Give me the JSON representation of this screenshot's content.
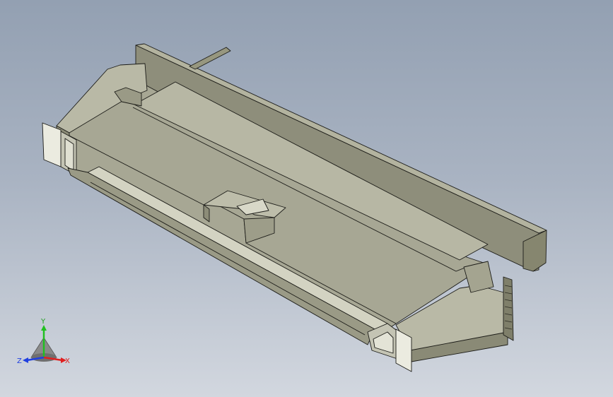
{
  "viewport": {
    "background_top": "#93a0b2",
    "background_bottom": "#d2d7df",
    "part_color": "#a3a38f",
    "edge_color": "#1c1c18"
  },
  "triad": {
    "x_label": "X",
    "y_label": "Y",
    "z_label": "Z",
    "x_color": "#e02020",
    "y_color": "#20c020",
    "z_color": "#2040e0"
  }
}
